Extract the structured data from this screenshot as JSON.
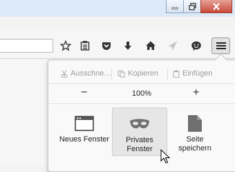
{
  "toolbar": {
    "icons": [
      "star-icon",
      "reading-list-icon",
      "pocket-icon",
      "download-icon",
      "home-icon",
      "send-icon",
      "chat-icon"
    ],
    "menu_icon": "hamburger-menu-icon"
  },
  "window_controls": [
    "minimize",
    "restore",
    "close"
  ],
  "menu": {
    "edit": {
      "cut": "Ausschne…",
      "copy": "Kopieren",
      "paste": "Einfügen"
    },
    "zoom": {
      "minus": "−",
      "value": "100%",
      "plus": "+"
    },
    "items": [
      {
        "label": "Neues Fenster",
        "icon": "new-window-icon"
      },
      {
        "label": "Privates Fenster",
        "icon": "private-mask-icon"
      },
      {
        "label": "Seite speichern",
        "icon": "save-page-icon"
      }
    ]
  },
  "colors": {
    "titlebar": "#dceaf8",
    "close": "#c74a3b",
    "panel": "#f9f9f9"
  }
}
